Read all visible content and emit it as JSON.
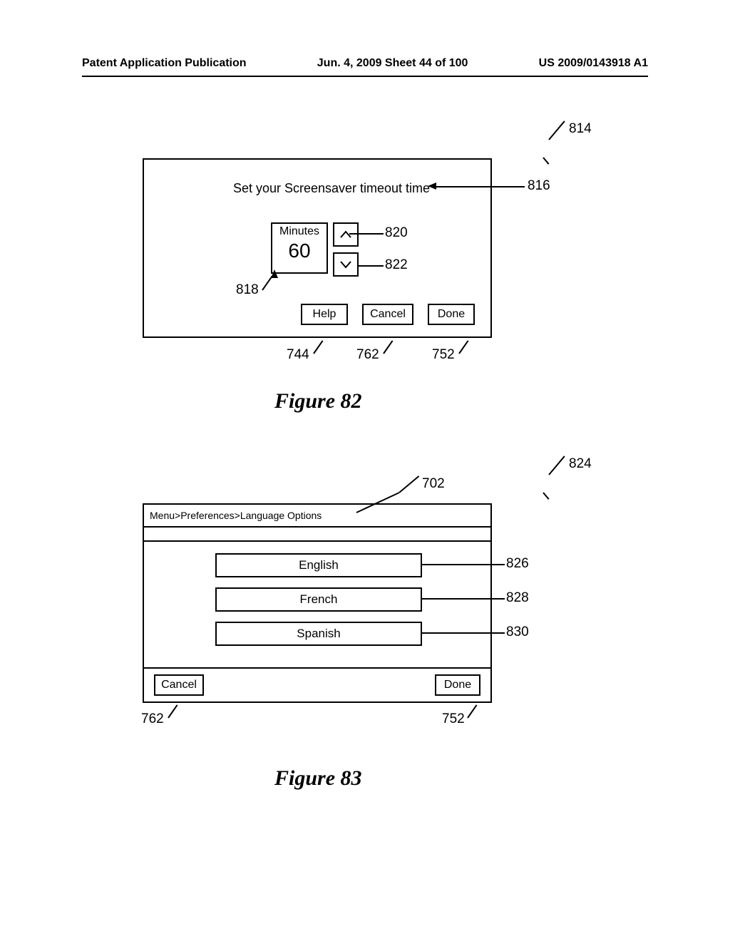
{
  "header": {
    "left": "Patent Application Publication",
    "center": "Jun. 4, 2009  Sheet 44 of 100",
    "right": "US 2009/0143918 A1"
  },
  "fig82": {
    "title": "Set your Screensaver timeout time",
    "minutes_label": "Minutes",
    "minutes_value": "60",
    "help": "Help",
    "cancel": "Cancel",
    "done": "Done",
    "caption": "Figure 82",
    "ref": {
      "screen": "814",
      "title": "816",
      "mins": "818",
      "up": "820",
      "down": "822",
      "help": "744",
      "cancel": "762",
      "done": "752"
    }
  },
  "fig83": {
    "breadcrumb": "Menu>Preferences>Language Options",
    "lang1": "English",
    "lang2": "French",
    "lang3": "Spanish",
    "cancel": "Cancel",
    "done": "Done",
    "caption": "Figure 83",
    "ref": {
      "screen": "824",
      "crumb": "702",
      "l1": "826",
      "l2": "828",
      "l3": "830",
      "cancel": "762",
      "done": "752"
    }
  }
}
